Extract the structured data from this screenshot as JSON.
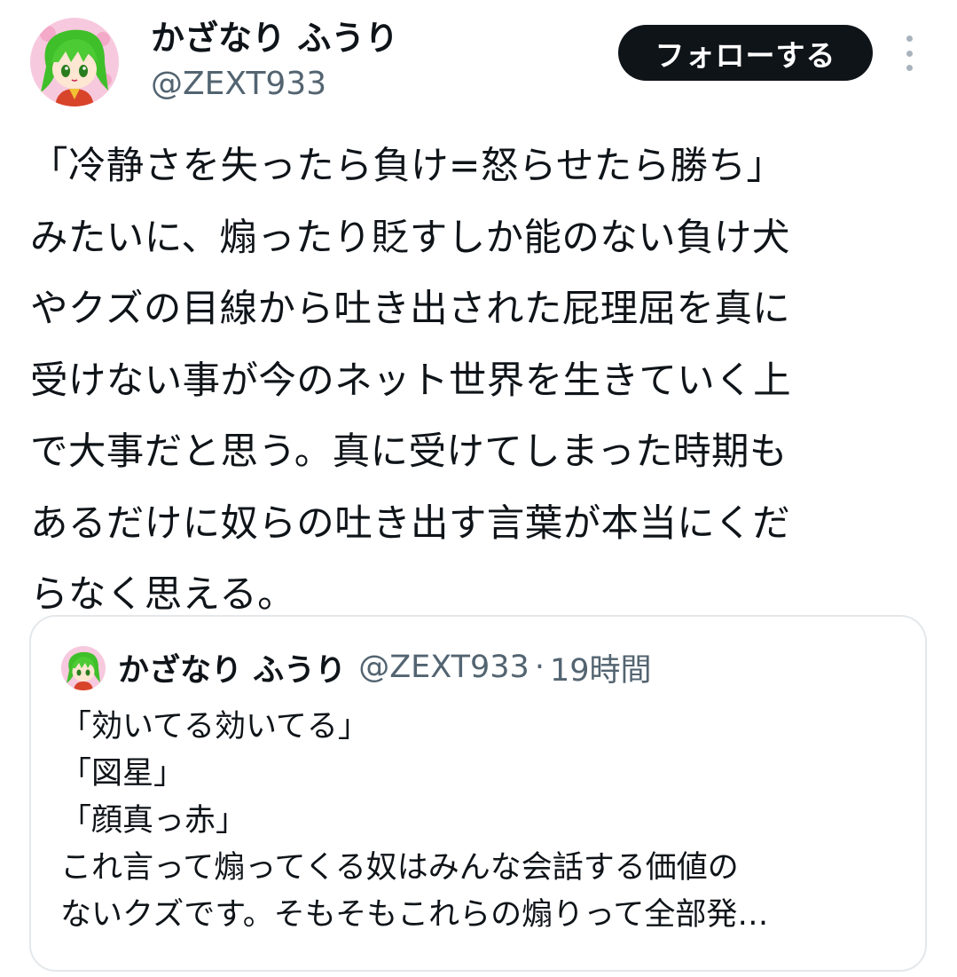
{
  "author": {
    "display_name": "かざなり ふうり",
    "handle": "@ZEXT933",
    "avatar_icon": "green-haired-character-avatar"
  },
  "follow_button": {
    "label": "フォローする"
  },
  "more_menu": {
    "icon": "more-vertical-icon"
  },
  "tweet": {
    "text": "「冷静さを失ったら負け=怒らせたら勝ち」\nみたいに、煽ったり貶すしか能のない負け犬\nやクズの目線から吐き出された屁理屈を真に\n受けない事が今のネット世界を生きていく上\nで大事だと思う。真に受けてしまった時期も\nあるだけに奴らの吐き出す言葉が本当にくだ\nらなく思える。"
  },
  "quoted_tweet": {
    "display_name": "かざなり ふうり",
    "handle": "@ZEXT933",
    "separator": "·",
    "time": "19時間",
    "avatar_icon": "green-haired-character-avatar",
    "text": "「効いてる効いてる」\n「図星」\n「顔真っ赤」\nこれ言って煽ってくる奴はみんな会話する価値の\nないクズです。そもそもこれらの煽りって全部発…"
  },
  "colors": {
    "text_primary": "#0f1419",
    "text_secondary": "#536471",
    "button_bg": "#0f1419",
    "card_border": "#e4e8eb",
    "avatar_hair": "#3fbf2a"
  }
}
